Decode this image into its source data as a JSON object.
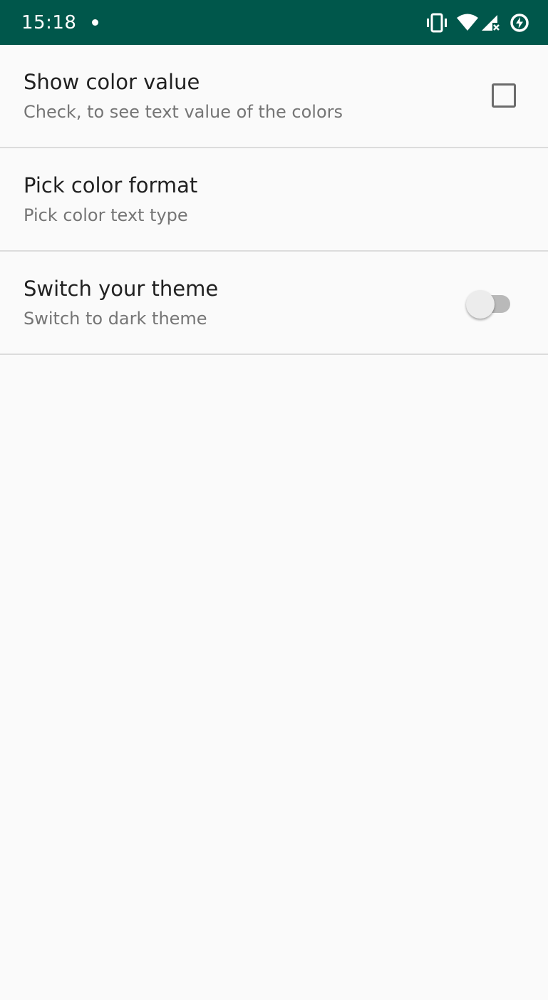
{
  "status_bar": {
    "time": "15:18",
    "background": "#00574b",
    "icons": [
      "notification-dot-icon",
      "vibrate-icon",
      "wifi-icon",
      "cellular-no-signal-icon",
      "data-saver-icon"
    ]
  },
  "preferences": [
    {
      "title": "Show color value",
      "summary": "Check, to see text value of the colors",
      "control": "checkbox",
      "checked": false
    },
    {
      "title": "Pick color format",
      "summary": "Pick color text type"
    },
    {
      "title": "Switch your theme",
      "summary": "Switch to dark theme",
      "control": "switch",
      "on": false
    }
  ]
}
